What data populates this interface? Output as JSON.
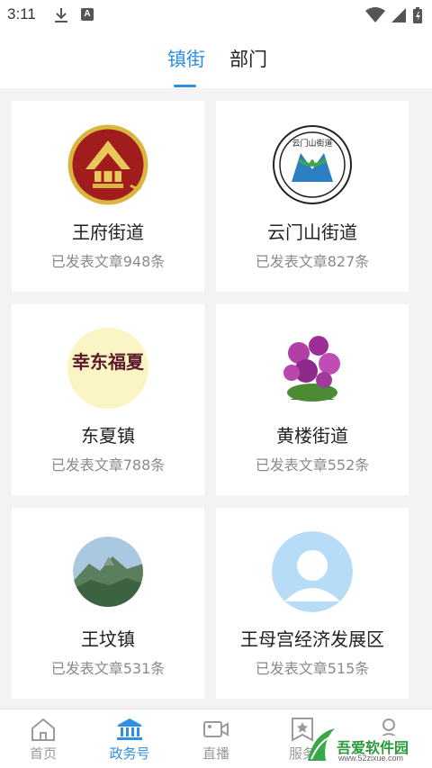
{
  "status_bar": {
    "time": "3:11",
    "notification_badge": "A"
  },
  "tabs": [
    {
      "label": "镇街",
      "active": true
    },
    {
      "label": "部门",
      "active": false
    }
  ],
  "cards": [
    {
      "title": "王府街道",
      "count": "已发表文章948条",
      "logo": "wangfu-logo"
    },
    {
      "title": "云门山街道",
      "count": "已发表文章827条",
      "logo": "yunmenshan-logo",
      "logo_text": "云门山街道"
    },
    {
      "title": "东夏镇",
      "count": "已发表文章788条",
      "logo": "dongxia-logo",
      "logo_text": "幸东福夏"
    },
    {
      "title": "黄楼街道",
      "count": "已发表文章552条",
      "logo": "huanglou-flower-image"
    },
    {
      "title": "王坟镇",
      "count": "已发表文章531条",
      "logo": "wangfen-mountain-image"
    },
    {
      "title": "王母宫经济发展区",
      "count": "已发表文章515条",
      "logo": "default-avatar"
    }
  ],
  "bottom_nav": [
    {
      "label": "首页",
      "icon": "home-icon",
      "active": false
    },
    {
      "label": "政务号",
      "icon": "government-building-icon",
      "active": true
    },
    {
      "label": "直播",
      "icon": "video-camera-icon",
      "active": false
    },
    {
      "label": "服务",
      "icon": "star-bookmark-icon",
      "active": false
    },
    {
      "label": "",
      "icon": "user-icon",
      "active": false
    }
  ],
  "watermark": {
    "text": "吾爱软件园",
    "url": "www.52zixue.com"
  },
  "colors": {
    "accent": "#2f8ee5",
    "background": "#f3f3f3",
    "muted": "#8a8a8a"
  }
}
